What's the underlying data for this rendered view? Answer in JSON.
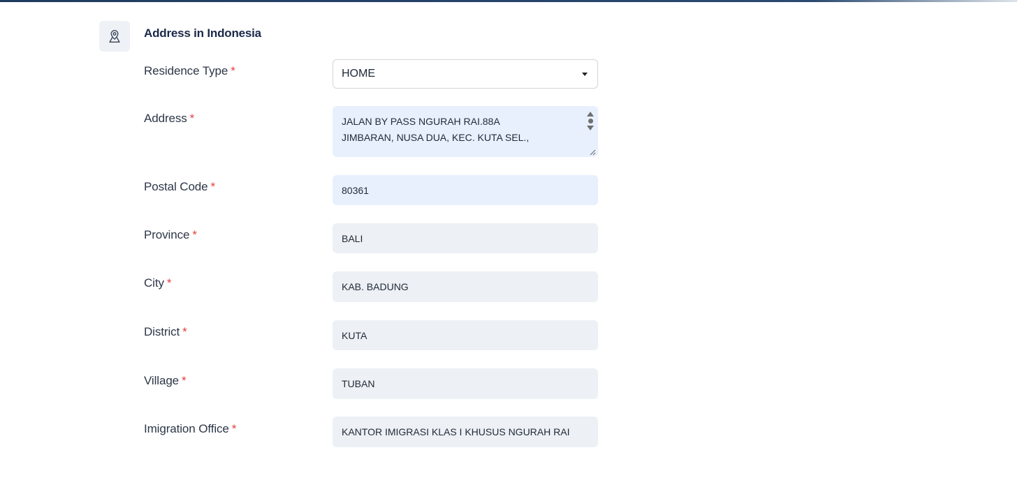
{
  "section": {
    "title": "Address in Indonesia",
    "icon": "map-pin-icon"
  },
  "required_marker": "*",
  "fields": {
    "residence_type": {
      "label": "Residence Type",
      "value": "HOME"
    },
    "address": {
      "label": "Address",
      "value_line1": "JALAN BY PASS NGURAH RAI.88A",
      "value_line2": "JIMBARAN, NUSA DUA, KEC. KUTA SEL.,"
    },
    "postal_code": {
      "label": "Postal Code",
      "value": "80361"
    },
    "province": {
      "label": "Province",
      "value": "BALI"
    },
    "city": {
      "label": "City",
      "value": "KAB. BADUNG"
    },
    "district": {
      "label": "District",
      "value": "KUTA"
    },
    "village": {
      "label": "Village",
      "value": "TUBAN"
    },
    "imigration_office": {
      "label": "Imigration Office",
      "value": "KANTOR IMIGRASI KLAS I KHUSUS NGURAH RAI"
    }
  },
  "colors": {
    "title": "#1b2a4a",
    "required": "#e53e3e",
    "autofill_bg": "#e8f0fe",
    "readonly_bg": "#edf0f4",
    "topline": "#1e3a5f"
  }
}
